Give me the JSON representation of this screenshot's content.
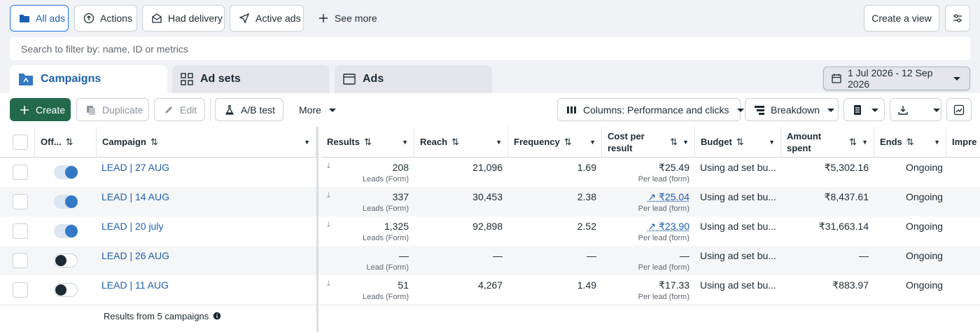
{
  "filters": {
    "all_ads": "All ads",
    "actions": "Actions",
    "had_delivery": "Had delivery",
    "active_ads": "Active ads",
    "see_more": "See more",
    "create_view": "Create a view"
  },
  "search": {
    "placeholder": "Search to filter by: name, ID or metrics"
  },
  "tabs": {
    "campaigns": "Campaigns",
    "adsets": "Ad sets",
    "ads": "Ads"
  },
  "date_range": "1 Jul 2026 - 12 Sep 2026",
  "toolbar": {
    "create": "Create",
    "duplicate": "Duplicate",
    "edit": "Edit",
    "ab_test": "A/B test",
    "more": "More",
    "columns": "Columns: Performance and clicks",
    "breakdown": "Breakdown"
  },
  "table": {
    "headers": {
      "offon": "Off...",
      "campaign": "Campaign",
      "results": "Results",
      "reach": "Reach",
      "frequency": "Frequency",
      "cost_per_result_1": "Cost per",
      "cost_per_result_2": "result",
      "budget": "Budget",
      "amount_spent_1": "Amount",
      "amount_spent_2": "spent",
      "ends": "Ends",
      "impressions": "Impre"
    },
    "rows": [
      {
        "name": "LEAD | 27 AUG",
        "on": true,
        "results": "208",
        "results_type": "Leads (Form)",
        "reach": "21,096",
        "frequency": "1.69",
        "cost": "₹25.49",
        "cost_type": "Per lead (form)",
        "budget": "Using ad set bu...",
        "spent": "₹5,302.16",
        "ends": "Ongoing"
      },
      {
        "name": "LEAD | 14 AUG",
        "on": true,
        "results": "337",
        "results_type": "Leads (Form)",
        "reach": "30,453",
        "frequency": "2.38",
        "cost": "₹25.04",
        "cost_type": "Per lead (form)",
        "budget": "Using ad set bu...",
        "spent": "₹8,437.61",
        "ends": "Ongoing"
      },
      {
        "name": "LEAD | 20 july",
        "on": true,
        "results": "1,325",
        "results_type": "Leads (Form)",
        "reach": "92,898",
        "frequency": "2.52",
        "cost": "₹23.90",
        "cost_type": "Per lead (form)",
        "budget": "Using ad set bu...",
        "spent": "₹31,663.14",
        "ends": "Ongoing"
      },
      {
        "name": "LEAD | 26 AUG",
        "on": false,
        "results": "—",
        "results_type": "Lead (Form)",
        "reach": "—",
        "frequency": "—",
        "cost": "—",
        "cost_type": "Per lead (form)",
        "budget": "Using ad set bu...",
        "spent": "—",
        "ends": "Ongoing"
      },
      {
        "name": "LEAD | 11 AUG",
        "on": false,
        "results": "51",
        "results_type": "Leads (Form)",
        "reach": "4,267",
        "frequency": "1.49",
        "cost": "₹17.33",
        "cost_type": "Per lead (form)",
        "budget": "Using ad set bu...",
        "spent": "₹883.97",
        "ends": "Ongoing"
      }
    ],
    "footer": "Results from 5 campaigns"
  }
}
